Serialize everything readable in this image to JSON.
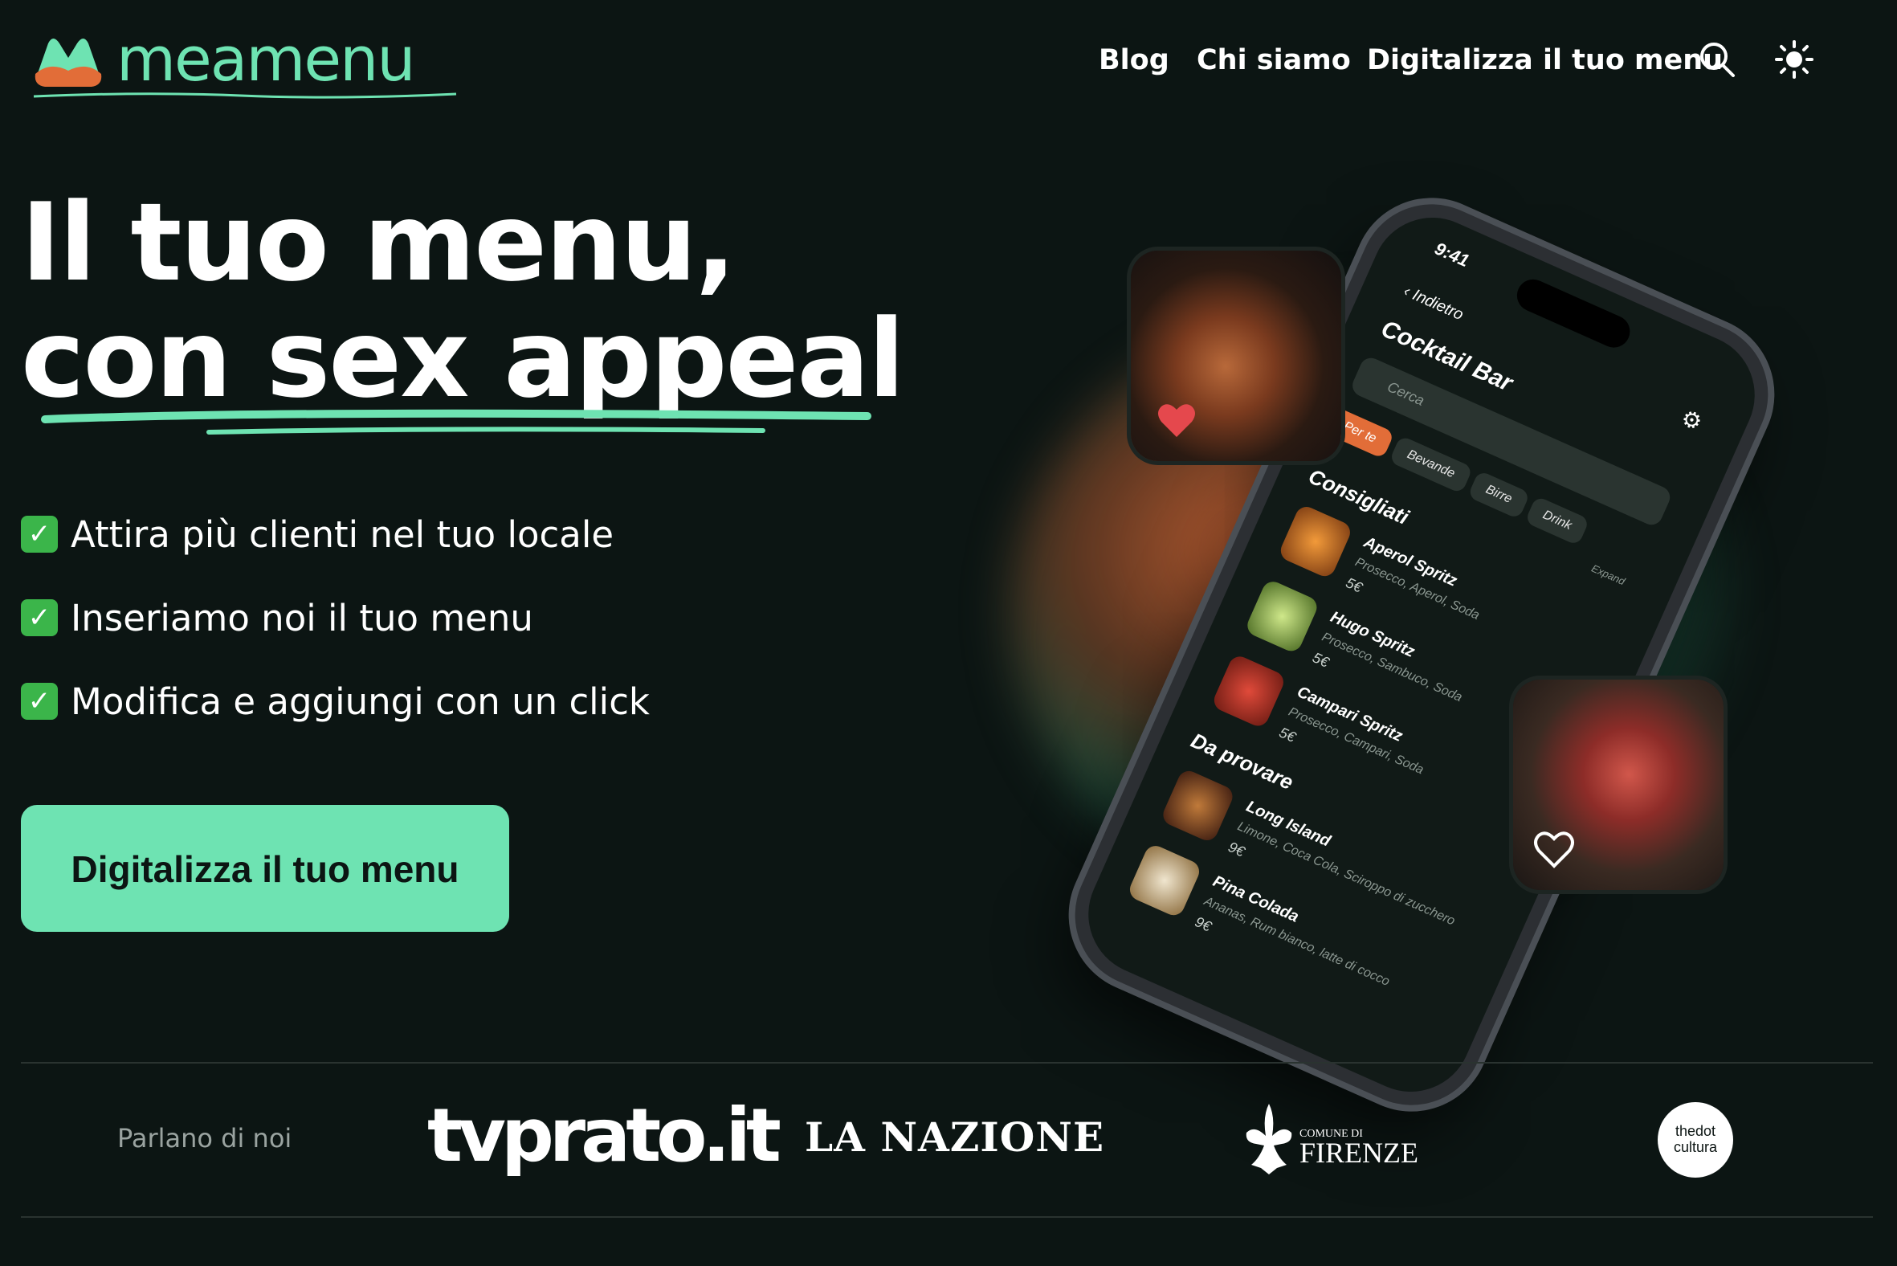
{
  "brand": {
    "name": "meamenu",
    "accent": "#6ee3b2",
    "orange": "#e26d38",
    "background": "#0c1513"
  },
  "nav": {
    "items": [
      "Blog",
      "Chi siamo",
      "Digitalizza il tuo menu"
    ],
    "search_icon": "search-icon",
    "theme_icon": "sun-icon"
  },
  "hero": {
    "title_line1": "Il tuo menu,",
    "title_line2": "con sex appeal",
    "features": [
      "Attira più clienti nel tuo locale",
      "Inseriamo noi il tuo menu",
      "Modifica e aggiungi con un click"
    ],
    "feature_icon": "check-mark-icon",
    "cta": "Digitalizza il tuo menu"
  },
  "phone": {
    "time": "9:41",
    "back": "Indietro",
    "title": "Cocktail Bar",
    "search_placeholder": "Cerca",
    "chips": [
      "Per te",
      "Bevande",
      "Birre",
      "Drink"
    ],
    "expand": "Expand",
    "sections": [
      {
        "title": "Consigliati",
        "items": [
          {
            "name": "Aperol Spritz",
            "desc": "Prosecco, Aperol, Soda",
            "price": "5€"
          },
          {
            "name": "Hugo Spritz",
            "desc": "Prosecco, Sambuco, Soda",
            "price": "5€"
          },
          {
            "name": "Campari Spritz",
            "desc": "Prosecco, Campari, Soda",
            "price": "5€"
          }
        ]
      },
      {
        "title": "Da provare",
        "items": [
          {
            "name": "Long Island",
            "desc": "Limone, Coca Cola, Sciroppo di zucchero",
            "price": "9€"
          },
          {
            "name": "Pina Colada",
            "desc": "Ananas, Rum bianco, latte di cocco",
            "price": "9€"
          }
        ]
      }
    ]
  },
  "press": {
    "label": "Parlano di noi",
    "tvprato": "tvprato.it",
    "nazione": "LA NAZIONE",
    "firenze_small": "COMUNE DI",
    "firenze": "FIRENZE",
    "thedot_line1": "thedot",
    "thedot_line2": "cultura"
  }
}
